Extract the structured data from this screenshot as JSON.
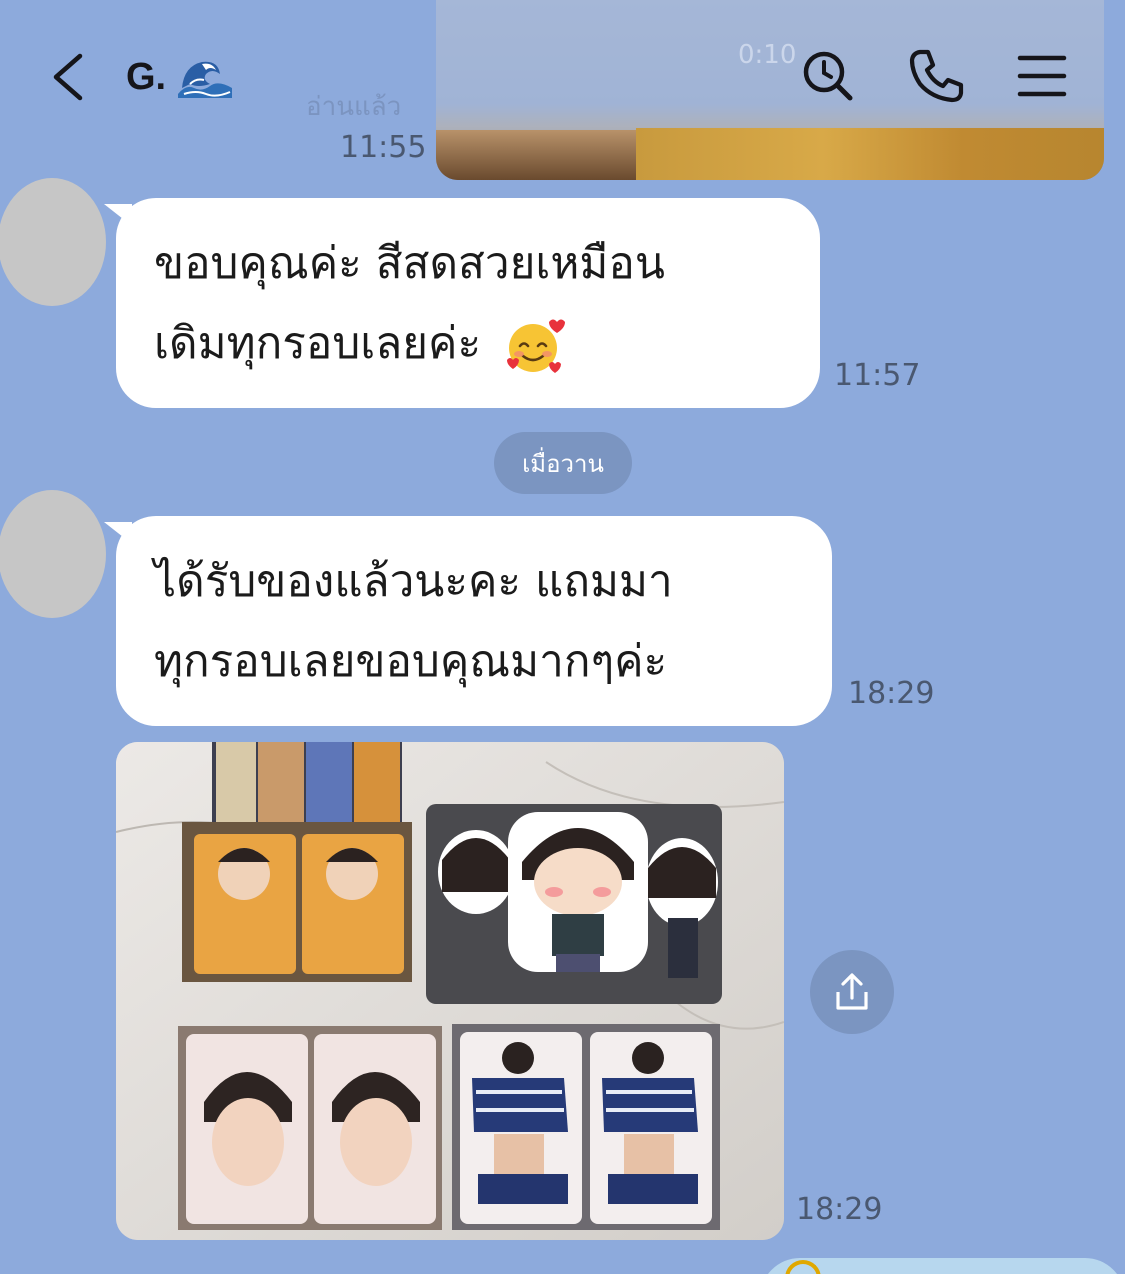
{
  "header": {
    "title": "G.",
    "title_emoji": "wave-icon",
    "icons": [
      "back-icon",
      "search-history-icon",
      "phone-icon",
      "menu-icon"
    ]
  },
  "ghost": {
    "read_label": "อ่านแล้ว",
    "video_time": "0:10"
  },
  "messages": [
    {
      "type": "image",
      "side": "right",
      "time": "11:55"
    },
    {
      "type": "text",
      "side": "left",
      "lines": [
        "ขอบคุณค่ะ สีสดสวยเหมือน",
        "เดิมทุกรอบเลยค่ะ"
      ],
      "emoji": "smiling-face-with-hearts-icon",
      "time": "11:57"
    },
    {
      "type": "date",
      "label": "เมื่อวาน"
    },
    {
      "type": "text",
      "side": "left",
      "lines": [
        "ได้รับของแล้วนะคะ แถมมา",
        "ทุกรอบเลยขอบคุณมากๆค่ะ"
      ],
      "time": "18:29"
    },
    {
      "type": "image",
      "side": "left",
      "time": "18:29"
    }
  ],
  "colors": {
    "background": "#8daadc",
    "bubble": "#ffffff",
    "chip": "#7b95c1",
    "avatar": "#c6c6c6"
  }
}
